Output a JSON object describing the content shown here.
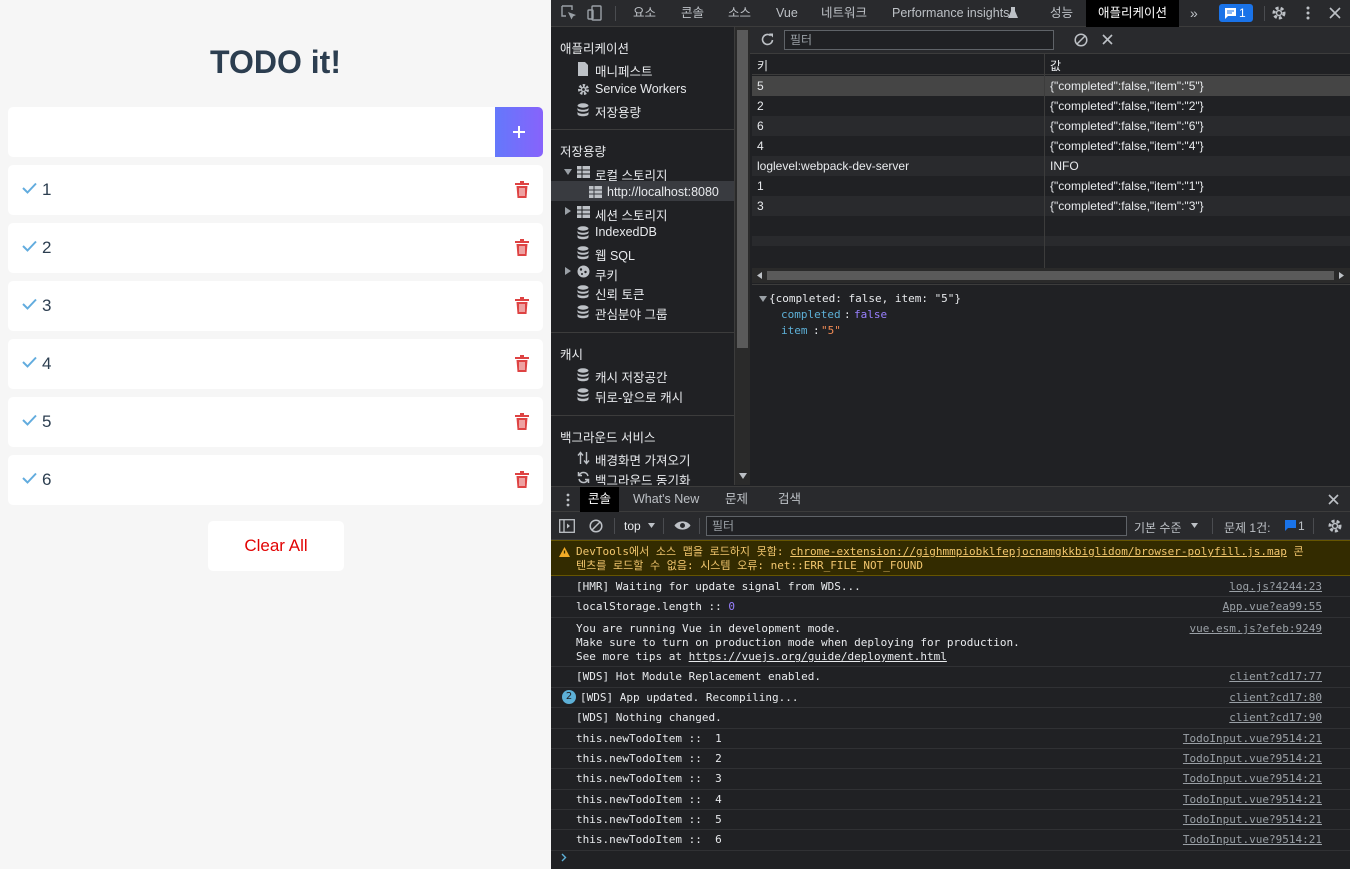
{
  "app": {
    "title": "TODO it!",
    "input_value": "",
    "add_icon": "plus-icon",
    "todos": [
      "1",
      "2",
      "3",
      "4",
      "5",
      "6"
    ],
    "clear_all_label": "Clear All"
  },
  "devtools": {
    "tabs": [
      "요소",
      "콘솔",
      "소스",
      "Vue",
      "네트워크",
      "Performance insights",
      "성능",
      "애플리케이션"
    ],
    "active_tab": "애플리케이션",
    "issues_badge_count": "1",
    "sidebar": {
      "app_heading": "애플리케이션",
      "app_items": [
        "매니페스트",
        "Service Workers",
        "저장용량"
      ],
      "storage_heading": "저장용량",
      "local_storage": "로컬 스토리지",
      "local_storage_origin": "http://localhost:8080",
      "session_storage": "세션 스토리지",
      "indexeddb": "IndexedDB",
      "web_sql": "웹 SQL",
      "cookies": "쿠키",
      "trust_tokens": "신뢰 토큰",
      "interest_groups": "관심분야 그룹",
      "cache_heading": "캐시",
      "cache_storage": "캐시 저장공간",
      "bfcache": "뒤로-앞으로 캐시",
      "bg_heading": "백그라운드 서비스",
      "bg_fetch": "배경화면 가져오기",
      "bg_sync": "백그라운드 동기화"
    },
    "storage": {
      "filter_placeholder": "필터",
      "col_key": "키",
      "col_value": "값",
      "rows": [
        {
          "k": "5",
          "v": "{\"completed\":false,\"item\":\"5\"}"
        },
        {
          "k": "2",
          "v": "{\"completed\":false,\"item\":\"2\"}"
        },
        {
          "k": "6",
          "v": "{\"completed\":false,\"item\":\"6\"}"
        },
        {
          "k": "4",
          "v": "{\"completed\":false,\"item\":\"4\"}"
        },
        {
          "k": "loglevel:webpack-dev-server",
          "v": "INFO"
        },
        {
          "k": "1",
          "v": "{\"completed\":false,\"item\":\"1\"}"
        },
        {
          "k": "3",
          "v": "{\"completed\":false,\"item\":\"3\"}"
        }
      ],
      "preview_summary": "{completed: false, item: \"5\"}",
      "preview_completed_key": "completed",
      "preview_completed_val": "false",
      "preview_item_key": "item",
      "preview_item_val": "\"5\""
    },
    "drawer": {
      "tabs": [
        "콘솔",
        "What's New",
        "문제",
        "검색"
      ],
      "context": "top",
      "filter_placeholder": "필터",
      "level": "기본 수준",
      "issues_label": "문제 1건:",
      "issues_count": "1"
    },
    "console": {
      "warning_prefix": "DevTools에서 소스 맵을 로드하지 못함: ",
      "warning_link": "chrome-extension://gighmmpiobklfepjocnamgkkbiglidom/browser-polyfill.js.map",
      "warning_suffix": " 콘",
      "warning_line2": "텐츠를 로드할 수 없음: 시스템 오류: net::ERR_FILE_NOT_FOUND",
      "messages": [
        {
          "text": "[HMR] Waiting for update signal from WDS...",
          "src": "log.js?4244:23"
        },
        {
          "text": "localStorage.length :: ",
          "num": "0",
          "src": "App.vue?ea99:55"
        },
        {
          "text": "You are running Vue in development mode.",
          "src": "vue.esm.js?efeb:9249"
        },
        {
          "text": "Make sure to turn on production mode when deploying for production."
        },
        {
          "text": "See more tips at ",
          "link": "https://vuejs.org/guide/deployment.html"
        },
        {
          "text": "[WDS] Hot Module Replacement enabled.",
          "src": "client?cd17:77"
        },
        {
          "text": "[WDS] App updated. Recompiling...",
          "src": "client?cd17:80",
          "count": "2"
        },
        {
          "text": "[WDS] Nothing changed.",
          "src": "client?cd17:90"
        },
        {
          "text": "this.newTodoItem ::  1",
          "src": "TodoInput.vue?9514:21"
        },
        {
          "text": "this.newTodoItem ::  2",
          "src": "TodoInput.vue?9514:21"
        },
        {
          "text": "this.newTodoItem ::  3",
          "src": "TodoInput.vue?9514:21"
        },
        {
          "text": "this.newTodoItem ::  4",
          "src": "TodoInput.vue?9514:21"
        },
        {
          "text": "this.newTodoItem ::  5",
          "src": "TodoInput.vue?9514:21"
        },
        {
          "text": "this.newTodoItem ::  6",
          "src": "TodoInput.vue?9514:21"
        }
      ]
    }
  },
  "colors": {
    "add_btn_gradient_start": "#6478fb",
    "add_btn_gradient_end": "#8763fb",
    "check": "#62acde",
    "trash": "#de4343",
    "clear_all": "#e20303",
    "devtools_bg": "#202124",
    "badge": "#1a73e8"
  }
}
